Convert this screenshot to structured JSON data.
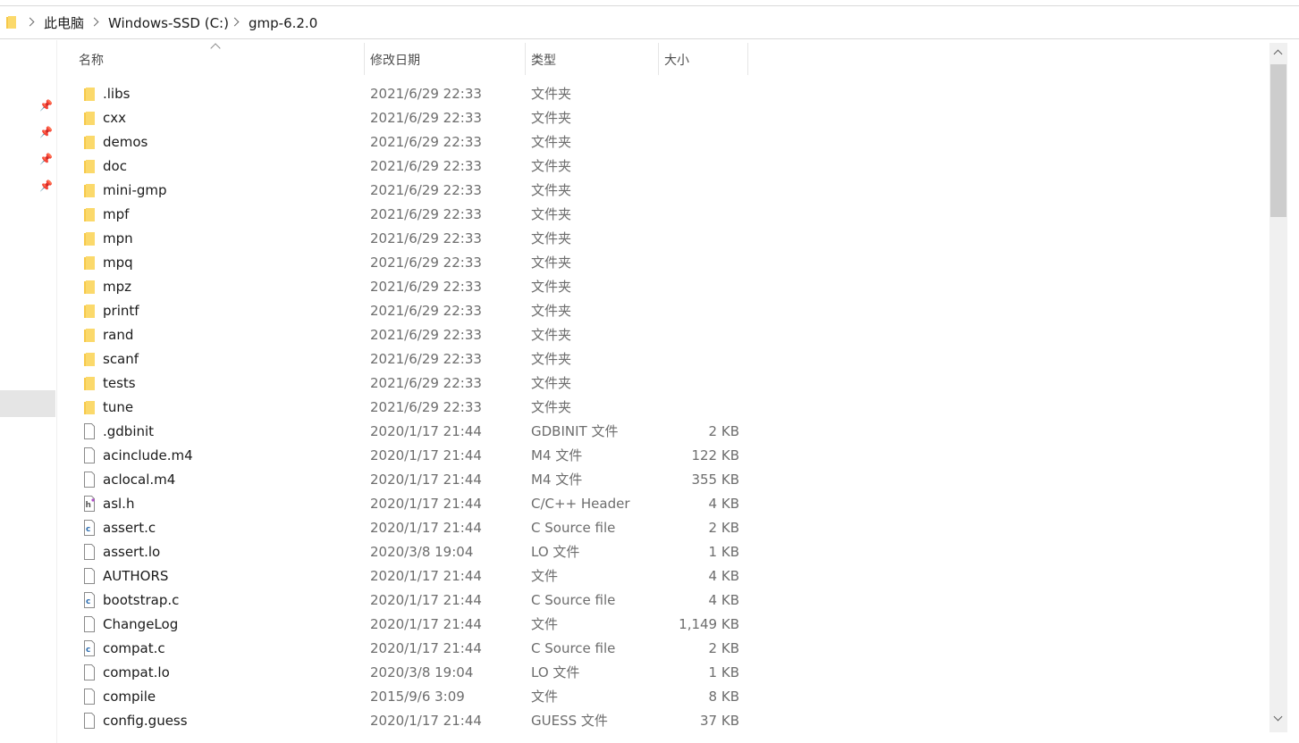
{
  "address_bar": {
    "crumbs": [
      "此电脑",
      "Windows-SSD (C:)",
      "gmp-6.2.0"
    ]
  },
  "columns": {
    "name": "名称",
    "date": "修改日期",
    "type": "类型",
    "size": "大小"
  },
  "icons": {
    "folder": "folder-icon",
    "file": "file-icon",
    "c_source": "c-source-file-icon",
    "header": "header-file-icon",
    "pin": "pin-icon"
  },
  "colors": {
    "folder": "#f6c94a",
    "c_badge": "#2b6cb0"
  },
  "files": [
    {
      "name": ".libs",
      "date": "2021/6/29 22:33",
      "type": "文件夹",
      "size": "",
      "icon": "folder"
    },
    {
      "name": "cxx",
      "date": "2021/6/29 22:33",
      "type": "文件夹",
      "size": "",
      "icon": "folder"
    },
    {
      "name": "demos",
      "date": "2021/6/29 22:33",
      "type": "文件夹",
      "size": "",
      "icon": "folder"
    },
    {
      "name": "doc",
      "date": "2021/6/29 22:33",
      "type": "文件夹",
      "size": "",
      "icon": "folder"
    },
    {
      "name": "mini-gmp",
      "date": "2021/6/29 22:33",
      "type": "文件夹",
      "size": "",
      "icon": "folder"
    },
    {
      "name": "mpf",
      "date": "2021/6/29 22:33",
      "type": "文件夹",
      "size": "",
      "icon": "folder"
    },
    {
      "name": "mpn",
      "date": "2021/6/29 22:33",
      "type": "文件夹",
      "size": "",
      "icon": "folder"
    },
    {
      "name": "mpq",
      "date": "2021/6/29 22:33",
      "type": "文件夹",
      "size": "",
      "icon": "folder"
    },
    {
      "name": "mpz",
      "date": "2021/6/29 22:33",
      "type": "文件夹",
      "size": "",
      "icon": "folder"
    },
    {
      "name": "printf",
      "date": "2021/6/29 22:33",
      "type": "文件夹",
      "size": "",
      "icon": "folder"
    },
    {
      "name": "rand",
      "date": "2021/6/29 22:33",
      "type": "文件夹",
      "size": "",
      "icon": "folder"
    },
    {
      "name": "scanf",
      "date": "2021/6/29 22:33",
      "type": "文件夹",
      "size": "",
      "icon": "folder"
    },
    {
      "name": "tests",
      "date": "2021/6/29 22:33",
      "type": "文件夹",
      "size": "",
      "icon": "folder"
    },
    {
      "name": "tune",
      "date": "2021/6/29 22:33",
      "type": "文件夹",
      "size": "",
      "icon": "folder"
    },
    {
      "name": ".gdbinit",
      "date": "2020/1/17 21:44",
      "type": "GDBINIT 文件",
      "size": "2 KB",
      "icon": "file"
    },
    {
      "name": "acinclude.m4",
      "date": "2020/1/17 21:44",
      "type": "M4 文件",
      "size": "122 KB",
      "icon": "file"
    },
    {
      "name": "aclocal.m4",
      "date": "2020/1/17 21:44",
      "type": "M4 文件",
      "size": "355 KB",
      "icon": "file"
    },
    {
      "name": "asl.h",
      "date": "2020/1/17 21:44",
      "type": "C/C++ Header",
      "size": "4 KB",
      "icon": "header"
    },
    {
      "name": "assert.c",
      "date": "2020/1/17 21:44",
      "type": "C Source file",
      "size": "2 KB",
      "icon": "c"
    },
    {
      "name": "assert.lo",
      "date": "2020/3/8 19:04",
      "type": "LO 文件",
      "size": "1 KB",
      "icon": "file"
    },
    {
      "name": "AUTHORS",
      "date": "2020/1/17 21:44",
      "type": "文件",
      "size": "4 KB",
      "icon": "file"
    },
    {
      "name": "bootstrap.c",
      "date": "2020/1/17 21:44",
      "type": "C Source file",
      "size": "4 KB",
      "icon": "c"
    },
    {
      "name": "ChangeLog",
      "date": "2020/1/17 21:44",
      "type": "文件",
      "size": "1,149 KB",
      "icon": "file"
    },
    {
      "name": "compat.c",
      "date": "2020/1/17 21:44",
      "type": "C Source file",
      "size": "2 KB",
      "icon": "c"
    },
    {
      "name": "compat.lo",
      "date": "2020/3/8 19:04",
      "type": "LO 文件",
      "size": "1 KB",
      "icon": "file"
    },
    {
      "name": "compile",
      "date": "2015/9/6 3:09",
      "type": "文件",
      "size": "8 KB",
      "icon": "file"
    },
    {
      "name": "config.guess",
      "date": "2020/1/17 21:44",
      "type": "GUESS 文件",
      "size": "37 KB",
      "icon": "file"
    }
  ]
}
